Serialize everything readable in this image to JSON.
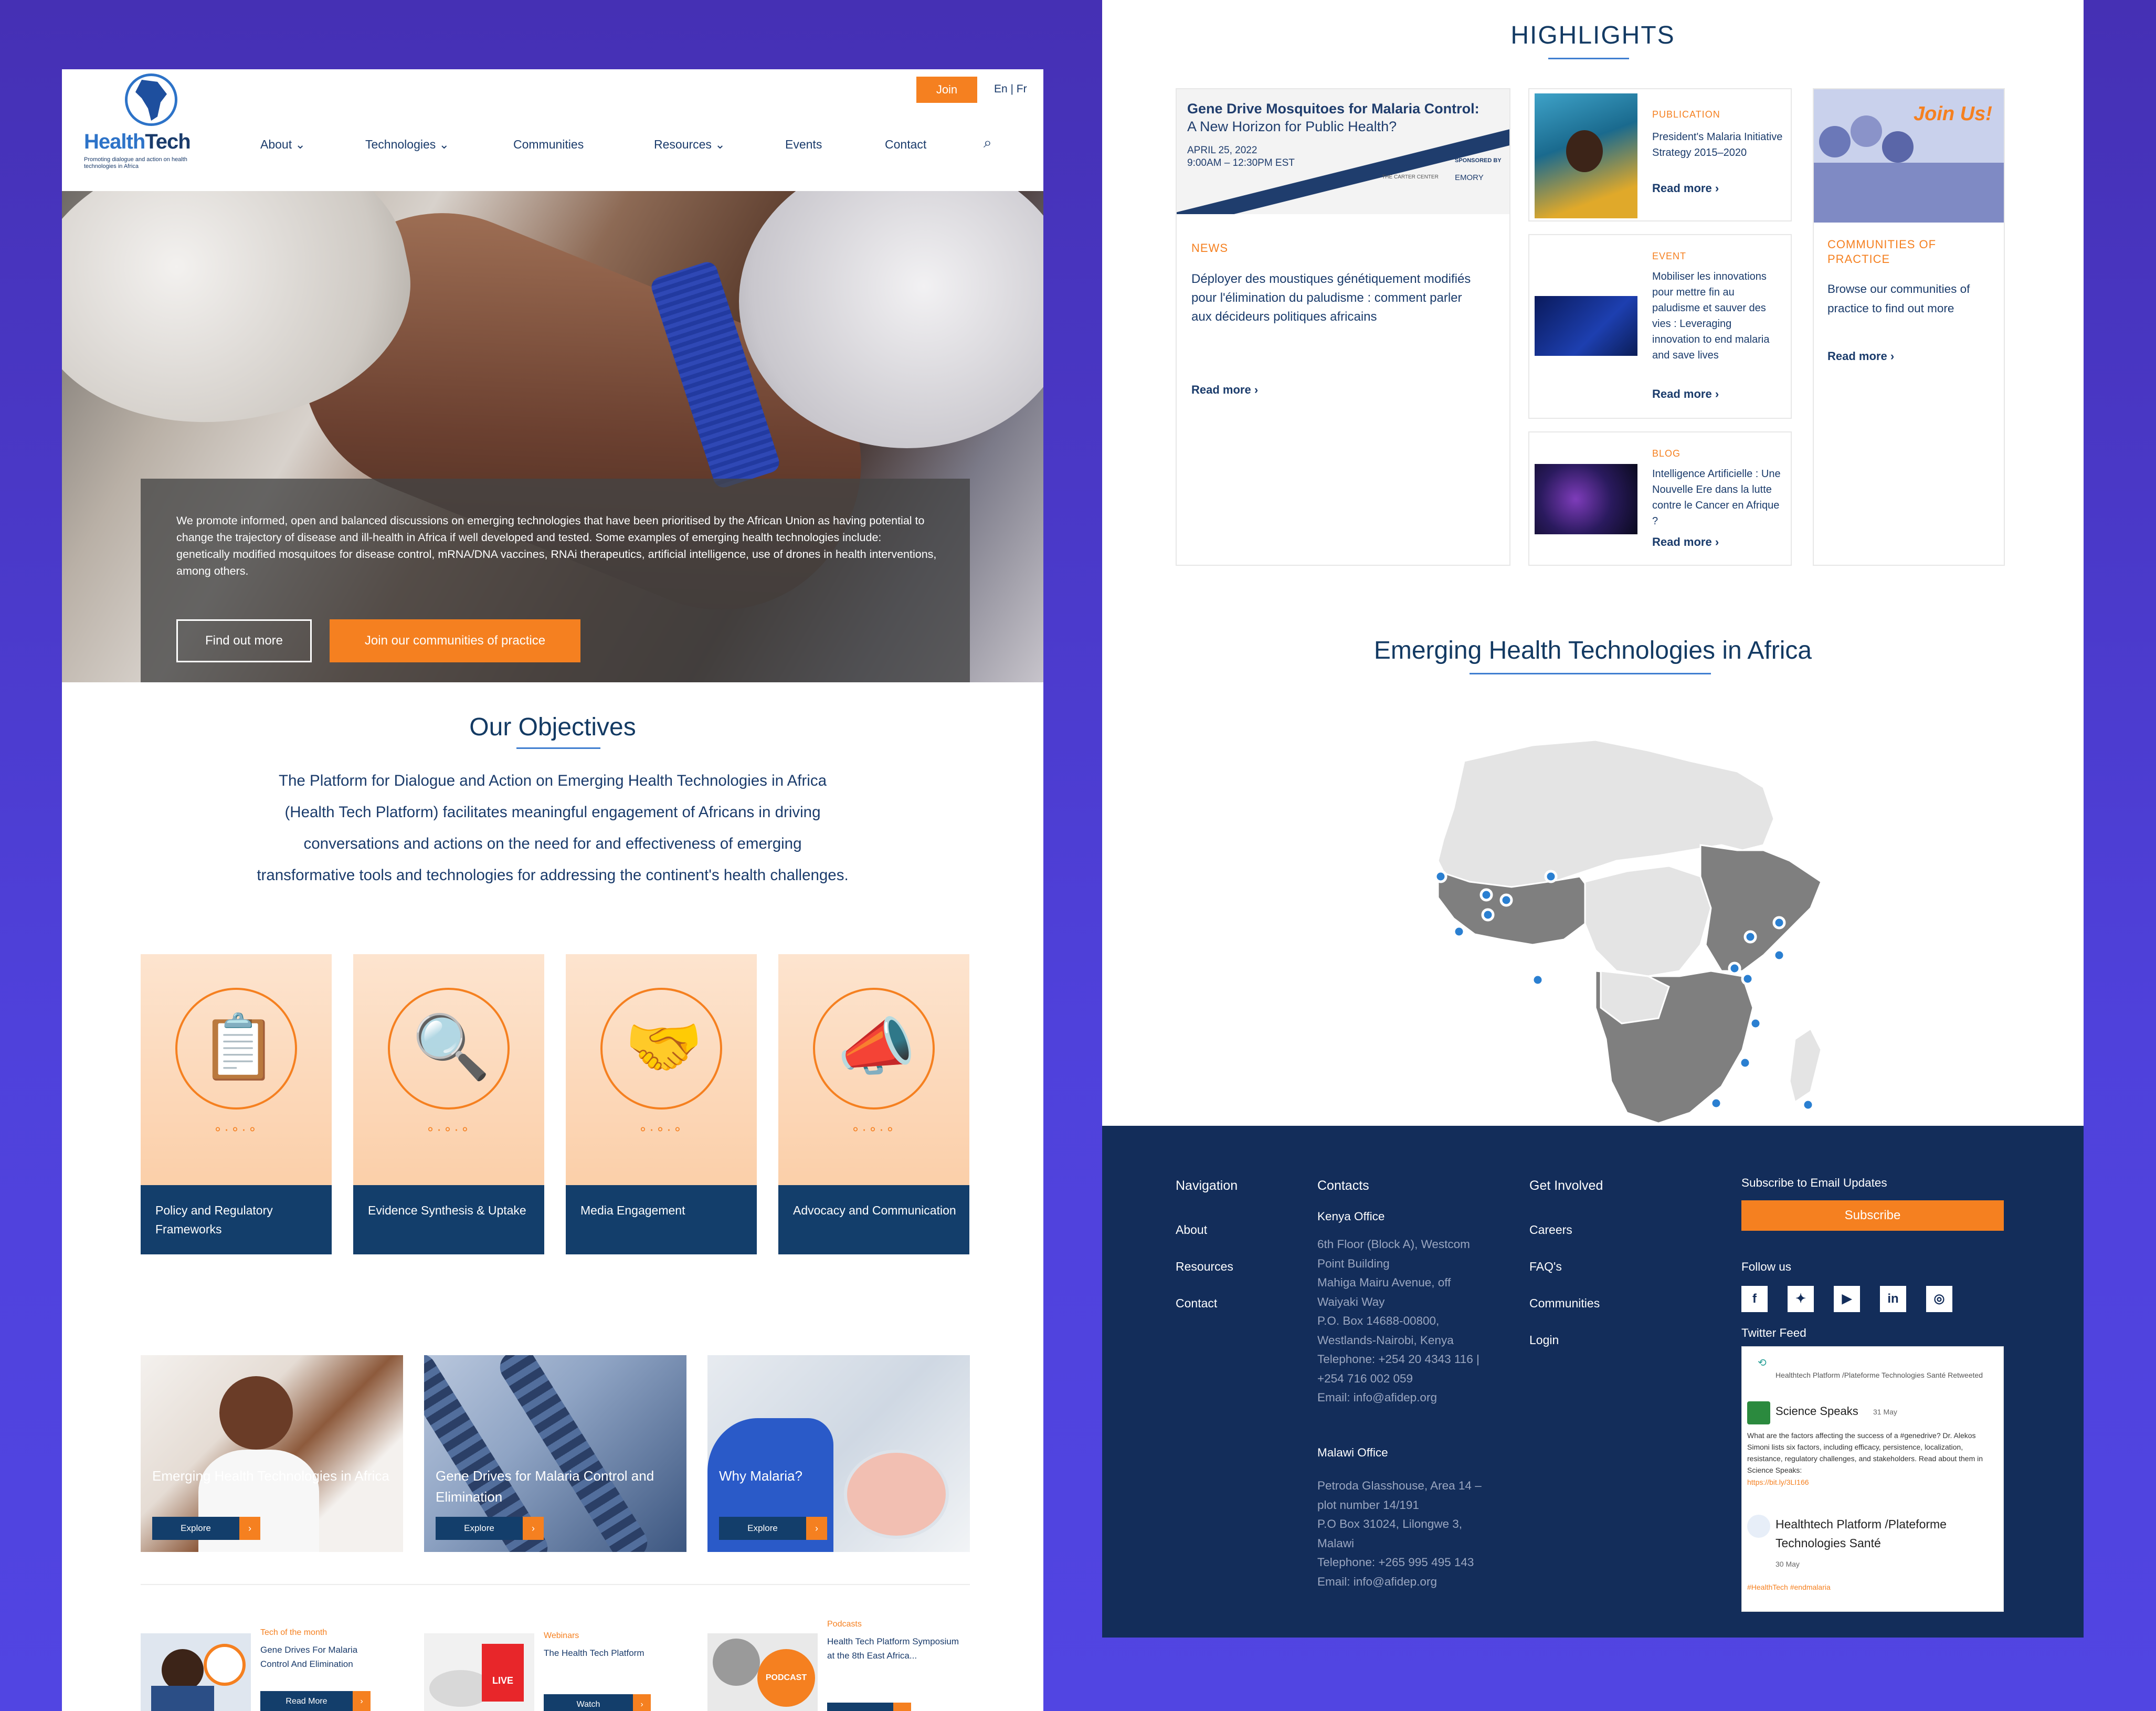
{
  "header": {
    "logo": {
      "name_a": "Health",
      "name_b": "Tech",
      "tagline": "Promoting dialogue and action on health technologies in Africa"
    },
    "nav": [
      "About",
      "Technologies",
      "Communities",
      "Resources",
      "Events",
      "Contact"
    ],
    "join_label": "Join",
    "lang": "En | Fr"
  },
  "hero": {
    "text": "We promote informed, open and balanced discussions on emerging technologies that have been prioritised by the African Union as having potential to change the trajectory of disease and ill-health in Africa if well developed and tested. Some examples of emerging health technologies include: genetically modified mosquitoes for disease control, mRNA/DNA vaccines, RNAi therapeutics, artificial intelligence, use of drones in health interventions, among others.",
    "btn_find": "Find out more",
    "btn_join": "Join our communities of practice"
  },
  "objectives": {
    "title": "Our Objectives",
    "text": "The Platform for Dialogue and Action on Emerging Health Technologies in Africa (Health Tech Platform) facilitates meaningful engagement of Africans in driving conversations and actions on the need for and effectiveness of emerging transformative tools and technologies for addressing the continent's health challenges.",
    "cards": [
      {
        "label": "Policy and Regulatory Frameworks",
        "icon": "clipboard-shield-icon"
      },
      {
        "label": "Evidence Synthesis & Uptake",
        "icon": "magnifier-dna-icon"
      },
      {
        "label": "Media Engagement",
        "icon": "handshake-icon"
      },
      {
        "label": "Advocacy and Communication",
        "icon": "megaphone-person-icon"
      }
    ]
  },
  "explore_cards": [
    {
      "caption": "Emerging Health Technologies in Africa",
      "btn": "Explore"
    },
    {
      "caption": "Gene Drives for Malaria Control and Elimination",
      "btn": "Explore"
    },
    {
      "caption": "Why Malaria?",
      "btn": "Explore"
    }
  ],
  "bottom_items": [
    {
      "category": "Tech of the month",
      "title": "Gene Drives For Malaria Control And Elimination",
      "btn": "Read More"
    },
    {
      "category": "Webinars",
      "title": "The Health Tech Platform",
      "btn": "Watch"
    },
    {
      "category": "Podcasts",
      "title": "Health Tech Platform Symposium at the 8th East Africa..."
    }
  ],
  "highlights": {
    "title": "HIGHLIGHTS",
    "news_banner": {
      "title": "Gene Drive Mosquitoes for Malaria Control:",
      "subtitle": "A New Horizon for Public Health?",
      "date": "APRIL 25, 2022",
      "time": "9:00AM – 12:30PM EST",
      "sponsored": "SPONSORED BY",
      "org1": "THE CARTER CENTER",
      "org2": "EMORY"
    },
    "news": {
      "category": "NEWS",
      "text": "Déployer des moustiques génétiquement modifiés pour l'élimination du paludisme : comment parler aux décideurs politiques africains",
      "more": "Read more"
    },
    "publication": {
      "category": "PUBLICATION",
      "text": "President's Malaria Initiative Strategy 2015–2020",
      "more": "Read more"
    },
    "event": {
      "category": "EVENT",
      "text": "Mobiliser les innovations pour mettre fin au paludisme et sauver des vies : Leveraging innovation to end malaria and save lives",
      "more": "Read more"
    },
    "blog": {
      "category": "BLOG",
      "text": "Intelligence Artificielle : Une Nouvelle Ere dans la lutte contre le Cancer en Afrique ?",
      "more": "Read more"
    },
    "communities": {
      "category": "COMMUNITIES OF PRACTICE",
      "text": "Browse our communities of practice to find out more",
      "more": "Read more",
      "join_art": "Join Us!"
    }
  },
  "map": {
    "title": "Emerging Health Technologies in Africa"
  },
  "footer": {
    "nav_title": "Navigation",
    "nav": [
      "About",
      "Resources",
      "Contact"
    ],
    "contacts_title": "Contacts",
    "kenya_title": "Kenya Office",
    "kenya": [
      "6th Floor (Block A), Westcom",
      "Point Building",
      "Mahiga Mairu Avenue, off",
      "Waiyaki Way",
      "P.O. Box 14688-00800,",
      "Westlands-Nairobi, Kenya",
      "Telephone: +254 20 4343 116 |",
      "+254 716 002 059",
      "Email: info@afidep.org"
    ],
    "malawi_title": "Malawi Office",
    "malawi": [
      "Petroda Glasshouse, Area 14 –",
      "plot number 14/191",
      "P.O Box 31024, Lilongwe 3,",
      "Malawi",
      "Telephone: +265 995 495 143",
      "Email: info@afidep.org"
    ],
    "involved_title": "Get Involved",
    "involved": [
      "Careers",
      "FAQ's",
      "Communities",
      "Login"
    ],
    "subscribe_title": "Subscribe to Email Updates",
    "subscribe_btn": "Subscribe",
    "follow": "Follow us",
    "social": [
      {
        "icon": "facebook-icon",
        "glyph": "f"
      },
      {
        "icon": "twitter-icon",
        "glyph": "✦"
      },
      {
        "icon": "youtube-icon",
        "glyph": "▶"
      },
      {
        "icon": "linkedin-icon",
        "glyph": "in"
      },
      {
        "icon": "instagram-icon",
        "glyph": "◎"
      }
    ],
    "twitter_title": "Twitter Feed",
    "tweet": {
      "retweet": "Healthtech Platform /Plateforme Technologies Santé Retweeted",
      "author": "Science Speaks",
      "date": "31 May",
      "body": "What are the factors affecting the success of a #genedrive? Dr. Alekos Simoni lists six factors, including efficacy, persistence, localization, resistance, regulatory challenges, and stakeholders. Read about them in Science Speaks:",
      "link": "https://bit.ly/3LI166",
      "author2": "Healthtech Platform /Plateforme Technologies Santé",
      "date2": "30 May",
      "tags": "#HealthTech #endmalaria"
    }
  },
  "colors": {
    "orange": "#f58020",
    "navy": "#133e6b",
    "footer": "#132d5a",
    "bg": "#4b3bd0"
  }
}
